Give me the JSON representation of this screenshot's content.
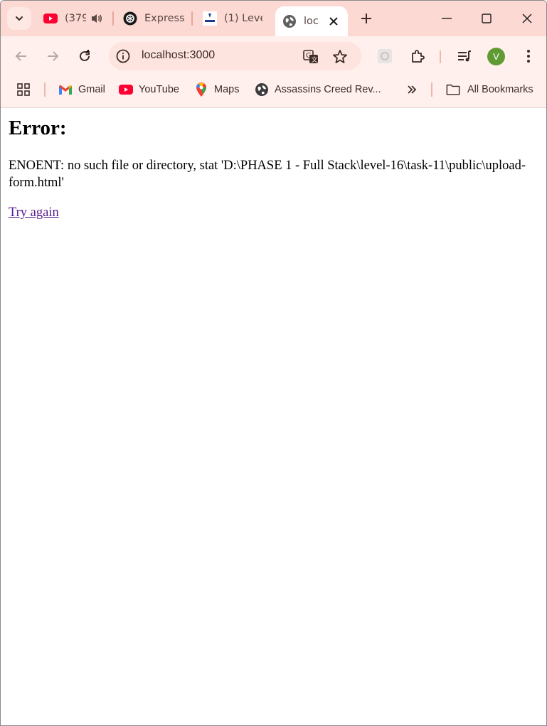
{
  "browser": {
    "tabs": [
      {
        "title": "(379",
        "icon": "youtube-icon",
        "audio": true
      },
      {
        "title": "Express",
        "icon": "chatgpt-icon"
      },
      {
        "title": "(1) Leve",
        "icon": "syncer-icon"
      },
      {
        "title": "loca",
        "icon": "globe-icon",
        "active": true
      }
    ],
    "address": "localhost:3000",
    "profile_initial": "V",
    "accent": "#fcd9d3"
  },
  "bookmarks": {
    "items": [
      {
        "label": "Gmail",
        "icon": "gmail-icon"
      },
      {
        "label": "YouTube",
        "icon": "youtube-icon"
      },
      {
        "label": "Maps",
        "icon": "maps-icon"
      },
      {
        "label": "Assassins Creed Rev...",
        "icon": "globe-icon"
      }
    ],
    "all_label": "All Bookmarks"
  },
  "page": {
    "heading": "Error:",
    "message": "ENOENT: no such file or directory, stat 'D:\\PHASE 1 - Full Stack\\level-16\\task-11\\public\\upload-form.html'",
    "link": "Try again",
    "link_color": "#551a8b"
  }
}
